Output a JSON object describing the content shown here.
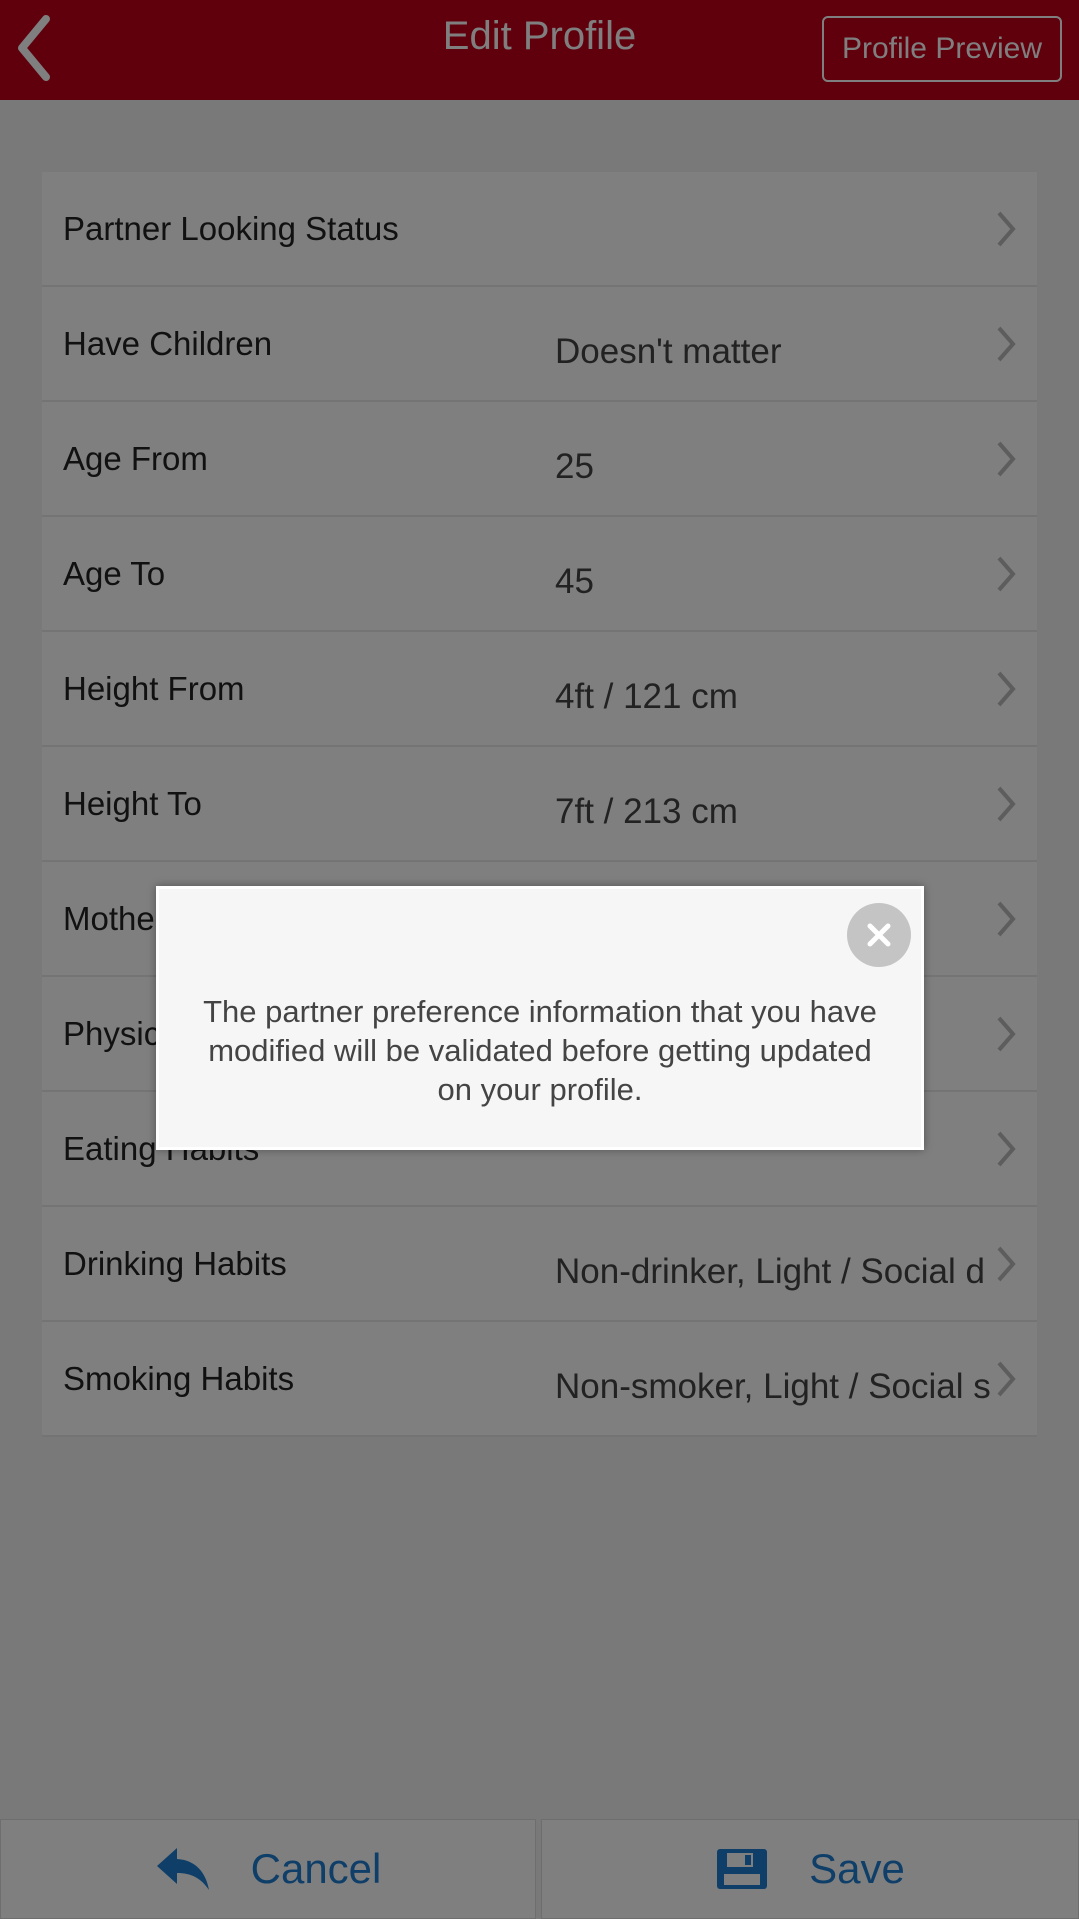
{
  "header": {
    "title": "Edit Profile",
    "preview_label": "Profile Preview",
    "color": "#c0001a"
  },
  "rows": [
    {
      "label": "Partner Looking Status",
      "value": ""
    },
    {
      "label": "Have Children",
      "value": "Doesn't matter"
    },
    {
      "label": "Age From",
      "value": "25"
    },
    {
      "label": "Age To",
      "value": "45"
    },
    {
      "label": "Height From",
      "value": "4ft / 121 cm"
    },
    {
      "label": "Height To",
      "value": "7ft / 213 cm"
    },
    {
      "label": "Mothe",
      "value": ""
    },
    {
      "label": "Physic",
      "value": ""
    },
    {
      "label": "Eating Habits",
      "value": ""
    },
    {
      "label": "Drinking Habits",
      "value": "Non-drinker, Light / Social d"
    },
    {
      "label": "Smoking Habits",
      "value": "Non-smoker, Light / Social s"
    }
  ],
  "footer": {
    "cancel_label": "Cancel",
    "save_label": "Save",
    "accent": "#1f7fd1"
  },
  "dialog": {
    "message": "The partner preference information that you have modified will be validated before getting updated on your profile.",
    "close_icon": "close-icon"
  }
}
